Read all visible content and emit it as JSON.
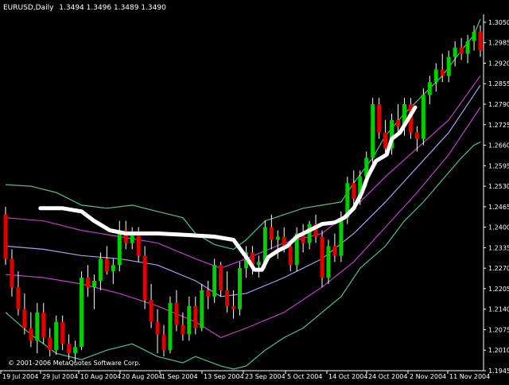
{
  "header": {
    "symbol_period": "EURUSD,Daily",
    "ohlc": "1.3494 1.3496 1.3489 1.3490"
  },
  "copyright": "© 2001-2006 MetaQuotes Software Corp.",
  "colors": {
    "background": "#000000",
    "axis": "#ffffff",
    "bull": "#00d000",
    "bear": "#e00000",
    "wick": "#ffffff",
    "band_outer": "#4fc28a",
    "band_middle": "#c040c8",
    "band_inner": "#b09ce8",
    "overlay": "#ffffff"
  },
  "chart_data": {
    "type": "candlestick",
    "title": "EURUSD,Daily",
    "ylim": [
      1.1945,
      1.3075
    ],
    "y_ticks": [
      "1.3050",
      "1.2985",
      "1.2920",
      "1.2855",
      "1.2790",
      "1.2725",
      "1.2660",
      "1.2595",
      "1.2530",
      "1.2465",
      "1.2400",
      "1.2335",
      "1.2270",
      "1.2205",
      "1.2140",
      "1.2075",
      "1.2010",
      "1.1945"
    ],
    "x_ticks": [
      "19 Jul 2004",
      "29 Jul 2004",
      "10 Aug 2004",
      "20 Aug 2004",
      "1 Sep 2004",
      "13 Sep 2004",
      "23 Sep 2004",
      "5 Oct 2004",
      "14 Oct 2004",
      "24 Oct 2004",
      "2 Nov 2004",
      "11 Nov 2004"
    ],
    "candles": [
      {
        "o": 1.244,
        "h": 1.2465,
        "l": 1.228,
        "c": 1.23
      },
      {
        "o": 1.23,
        "h": 1.233,
        "l": 1.218,
        "c": 1.221
      },
      {
        "o": 1.221,
        "h": 1.226,
        "l": 1.212,
        "c": 1.214
      },
      {
        "o": 1.214,
        "h": 1.219,
        "l": 1.206,
        "c": 1.208
      },
      {
        "o": 1.208,
        "h": 1.213,
        "l": 1.202,
        "c": 1.204
      },
      {
        "o": 1.204,
        "h": 1.216,
        "l": 1.2,
        "c": 1.213
      },
      {
        "o": 1.213,
        "h": 1.216,
        "l": 1.203,
        "c": 1.205
      },
      {
        "o": 1.205,
        "h": 1.208,
        "l": 1.199,
        "c": 1.201
      },
      {
        "o": 1.201,
        "h": 1.212,
        "l": 1.1995,
        "c": 1.21
      },
      {
        "o": 1.21,
        "h": 1.212,
        "l": 1.201,
        "c": 1.203
      },
      {
        "o": 1.203,
        "h": 1.206,
        "l": 1.198,
        "c": 1.2
      },
      {
        "o": 1.2,
        "h": 1.204,
        "l": 1.197,
        "c": 1.202
      },
      {
        "o": 1.202,
        "h": 1.226,
        "l": 1.201,
        "c": 1.224
      },
      {
        "o": 1.224,
        "h": 1.228,
        "l": 1.218,
        "c": 1.221
      },
      {
        "o": 1.221,
        "h": 1.225,
        "l": 1.214,
        "c": 1.223
      },
      {
        "o": 1.223,
        "h": 1.232,
        "l": 1.22,
        "c": 1.23
      },
      {
        "o": 1.23,
        "h": 1.234,
        "l": 1.225,
        "c": 1.226
      },
      {
        "o": 1.226,
        "h": 1.23,
        "l": 1.222,
        "c": 1.228
      },
      {
        "o": 1.228,
        "h": 1.242,
        "l": 1.226,
        "c": 1.239
      },
      {
        "o": 1.239,
        "h": 1.242,
        "l": 1.233,
        "c": 1.235
      },
      {
        "o": 1.235,
        "h": 1.24,
        "l": 1.233,
        "c": 1.238
      },
      {
        "o": 1.238,
        "h": 1.24,
        "l": 1.229,
        "c": 1.231
      },
      {
        "o": 1.231,
        "h": 1.234,
        "l": 1.214,
        "c": 1.217
      },
      {
        "o": 1.217,
        "h": 1.222,
        "l": 1.208,
        "c": 1.21
      },
      {
        "o": 1.21,
        "h": 1.214,
        "l": 1.2,
        "c": 1.206
      },
      {
        "o": 1.206,
        "h": 1.209,
        "l": 1.199,
        "c": 1.201
      },
      {
        "o": 1.201,
        "h": 1.218,
        "l": 1.2,
        "c": 1.216
      },
      {
        "o": 1.216,
        "h": 1.22,
        "l": 1.207,
        "c": 1.209
      },
      {
        "o": 1.209,
        "h": 1.213,
        "l": 1.204,
        "c": 1.206
      },
      {
        "o": 1.206,
        "h": 1.218,
        "l": 1.204,
        "c": 1.215
      },
      {
        "o": 1.215,
        "h": 1.218,
        "l": 1.206,
        "c": 1.208
      },
      {
        "o": 1.208,
        "h": 1.222,
        "l": 1.207,
        "c": 1.22
      },
      {
        "o": 1.22,
        "h": 1.223,
        "l": 1.214,
        "c": 1.218
      },
      {
        "o": 1.218,
        "h": 1.23,
        "l": 1.216,
        "c": 1.228
      },
      {
        "o": 1.228,
        "h": 1.229,
        "l": 1.218,
        "c": 1.22
      },
      {
        "o": 1.22,
        "h": 1.226,
        "l": 1.213,
        "c": 1.215
      },
      {
        "o": 1.215,
        "h": 1.22,
        "l": 1.211,
        "c": 1.214
      },
      {
        "o": 1.214,
        "h": 1.229,
        "l": 1.212,
        "c": 1.227
      },
      {
        "o": 1.227,
        "h": 1.234,
        "l": 1.224,
        "c": 1.232
      },
      {
        "o": 1.232,
        "h": 1.234,
        "l": 1.225,
        "c": 1.228
      },
      {
        "o": 1.228,
        "h": 1.231,
        "l": 1.224,
        "c": 1.229
      },
      {
        "o": 1.229,
        "h": 1.242,
        "l": 1.227,
        "c": 1.24
      },
      {
        "o": 1.24,
        "h": 1.244,
        "l": 1.233,
        "c": 1.236
      },
      {
        "o": 1.236,
        "h": 1.239,
        "l": 1.23,
        "c": 1.237
      },
      {
        "o": 1.237,
        "h": 1.24,
        "l": 1.232,
        "c": 1.234
      },
      {
        "o": 1.234,
        "h": 1.236,
        "l": 1.226,
        "c": 1.228
      },
      {
        "o": 1.228,
        "h": 1.24,
        "l": 1.226,
        "c": 1.238
      },
      {
        "o": 1.238,
        "h": 1.241,
        "l": 1.232,
        "c": 1.235
      },
      {
        "o": 1.235,
        "h": 1.242,
        "l": 1.233,
        "c": 1.241
      },
      {
        "o": 1.241,
        "h": 1.244,
        "l": 1.235,
        "c": 1.237
      },
      {
        "o": 1.237,
        "h": 1.239,
        "l": 1.221,
        "c": 1.224
      },
      {
        "o": 1.224,
        "h": 1.236,
        "l": 1.222,
        "c": 1.234
      },
      {
        "o": 1.234,
        "h": 1.238,
        "l": 1.229,
        "c": 1.231
      },
      {
        "o": 1.231,
        "h": 1.245,
        "l": 1.229,
        "c": 1.243
      },
      {
        "o": 1.243,
        "h": 1.256,
        "l": 1.241,
        "c": 1.254
      },
      {
        "o": 1.254,
        "h": 1.258,
        "l": 1.247,
        "c": 1.249
      },
      {
        "o": 1.249,
        "h": 1.258,
        "l": 1.247,
        "c": 1.256
      },
      {
        "o": 1.256,
        "h": 1.264,
        "l": 1.253,
        "c": 1.262
      },
      {
        "o": 1.262,
        "h": 1.281,
        "l": 1.26,
        "c": 1.279
      },
      {
        "o": 1.279,
        "h": 1.281,
        "l": 1.268,
        "c": 1.27
      },
      {
        "o": 1.27,
        "h": 1.274,
        "l": 1.262,
        "c": 1.265
      },
      {
        "o": 1.265,
        "h": 1.276,
        "l": 1.263,
        "c": 1.274
      },
      {
        "o": 1.274,
        "h": 1.279,
        "l": 1.27,
        "c": 1.272
      },
      {
        "o": 1.272,
        "h": 1.281,
        "l": 1.269,
        "c": 1.279
      },
      {
        "o": 1.279,
        "h": 1.281,
        "l": 1.268,
        "c": 1.27
      },
      {
        "o": 1.27,
        "h": 1.272,
        "l": 1.264,
        "c": 1.268
      },
      {
        "o": 1.268,
        "h": 1.284,
        "l": 1.266,
        "c": 1.282
      },
      {
        "o": 1.282,
        "h": 1.288,
        "l": 1.279,
        "c": 1.286
      },
      {
        "o": 1.286,
        "h": 1.292,
        "l": 1.283,
        "c": 1.29
      },
      {
        "o": 1.29,
        "h": 1.295,
        "l": 1.286,
        "c": 1.288
      },
      {
        "o": 1.288,
        "h": 1.296,
        "l": 1.286,
        "c": 1.294
      },
      {
        "o": 1.294,
        "h": 1.299,
        "l": 1.291,
        "c": 1.297
      },
      {
        "o": 1.297,
        "h": 1.3,
        "l": 1.293,
        "c": 1.295
      },
      {
        "o": 1.295,
        "h": 1.301,
        "l": 1.292,
        "c": 1.299
      },
      {
        "o": 1.299,
        "h": 1.304,
        "l": 1.296,
        "c": 1.302
      },
      {
        "o": 1.302,
        "h": 1.304,
        "l": 1.294,
        "c": 1.296
      }
    ],
    "envelope_lines": [
      {
        "name": "outer-upper",
        "color": "#4fc28a",
        "points": [
          [
            0,
            1.2535
          ],
          [
            4,
            1.253
          ],
          [
            8,
            1.251
          ],
          [
            12,
            1.247
          ],
          [
            16,
            1.246
          ],
          [
            20,
            1.247
          ],
          [
            24,
            1.245
          ],
          [
            28,
            1.243
          ],
          [
            30,
            1.238
          ],
          [
            33,
            1.2345
          ],
          [
            36,
            1.233
          ],
          [
            38,
            1.236
          ],
          [
            41,
            1.242
          ],
          [
            44,
            1.244
          ],
          [
            47,
            1.246
          ],
          [
            50,
            1.247
          ],
          [
            53,
            1.248
          ],
          [
            55,
            1.254
          ],
          [
            58,
            1.262
          ],
          [
            60,
            1.269
          ],
          [
            63,
            1.276
          ],
          [
            66,
            1.282
          ],
          [
            69,
            1.288
          ],
          [
            72,
            1.296
          ],
          [
            74,
            1.301
          ],
          [
            75,
            1.306
          ]
        ]
      },
      {
        "name": "middle-upper",
        "color": "#c040c8",
        "points": [
          [
            0,
            1.243
          ],
          [
            6,
            1.242
          ],
          [
            12,
            1.239
          ],
          [
            18,
            1.237
          ],
          [
            24,
            1.235
          ],
          [
            30,
            1.23
          ],
          [
            34,
            1.227
          ],
          [
            38,
            1.23
          ],
          [
            44,
            1.235
          ],
          [
            50,
            1.238
          ],
          [
            55,
            1.246
          ],
          [
            60,
            1.256
          ],
          [
            65,
            1.265
          ],
          [
            70,
            1.274
          ],
          [
            75,
            1.288
          ]
        ]
      },
      {
        "name": "inner-middle",
        "color": "#b09ce8",
        "points": [
          [
            0,
            1.234
          ],
          [
            6,
            1.233
          ],
          [
            12,
            1.231
          ],
          [
            18,
            1.23
          ],
          [
            24,
            1.228
          ],
          [
            30,
            1.223
          ],
          [
            34,
            1.218
          ],
          [
            38,
            1.219
          ],
          [
            44,
            1.224
          ],
          [
            50,
            1.23
          ],
          [
            55,
            1.238
          ],
          [
            60,
            1.248
          ],
          [
            65,
            1.259
          ],
          [
            70,
            1.27
          ],
          [
            75,
            1.285
          ]
        ]
      },
      {
        "name": "middle-lower",
        "color": "#c040c8",
        "points": [
          [
            0,
            1.225
          ],
          [
            6,
            1.224
          ],
          [
            12,
            1.222
          ],
          [
            18,
            1.219
          ],
          [
            24,
            1.215
          ],
          [
            30,
            1.21
          ],
          [
            34,
            1.205
          ],
          [
            38,
            1.208
          ],
          [
            44,
            1.213
          ],
          [
            50,
            1.221
          ],
          [
            55,
            1.229
          ],
          [
            60,
            1.24
          ],
          [
            65,
            1.251
          ],
          [
            70,
            1.263
          ],
          [
            75,
            1.278
          ]
        ]
      },
      {
        "name": "outer-lower",
        "color": "#4fc28a",
        "points": [
          [
            0,
            1.213
          ],
          [
            4,
            1.206
          ],
          [
            8,
            1.2
          ],
          [
            12,
            1.198
          ],
          [
            16,
            1.201
          ],
          [
            20,
            1.203
          ],
          [
            24,
            1.199
          ],
          [
            28,
            1.197
          ],
          [
            30,
            1.199
          ],
          [
            34,
            1.196
          ],
          [
            36,
            1.195
          ],
          [
            38,
            1.196
          ],
          [
            41,
            1.201
          ],
          [
            44,
            1.205
          ],
          [
            47,
            1.208
          ],
          [
            50,
            1.213
          ],
          [
            53,
            1.218
          ],
          [
            56,
            1.227
          ],
          [
            60,
            1.234
          ],
          [
            63,
            1.242
          ],
          [
            66,
            1.248
          ],
          [
            69,
            1.255
          ],
          [
            72,
            1.262
          ],
          [
            74,
            1.266
          ],
          [
            75,
            1.267
          ]
        ]
      }
    ],
    "overlay_line": {
      "color": "#ffffff",
      "points": [
        [
          5.5,
          1.246
        ],
        [
          9,
          1.246
        ],
        [
          12,
          1.245
        ],
        [
          14,
          1.242
        ],
        [
          16.5,
          1.239
        ],
        [
          19,
          1.238
        ],
        [
          24,
          1.238
        ],
        [
          29,
          1.2375
        ],
        [
          33,
          1.237
        ],
        [
          36,
          1.236
        ],
        [
          38.2,
          1.23
        ],
        [
          39.3,
          1.2265
        ],
        [
          40.5,
          1.2265
        ],
        [
          41.5,
          1.2305
        ],
        [
          43,
          1.2325
        ],
        [
          44.5,
          1.234
        ],
        [
          46,
          1.237
        ],
        [
          48,
          1.239
        ],
        [
          50,
          1.241
        ],
        [
          52,
          1.2415
        ],
        [
          53.5,
          1.243
        ],
        [
          55,
          1.246
        ],
        [
          56.3,
          1.251
        ],
        [
          57.2,
          1.256
        ],
        [
          58.5,
          1.261
        ],
        [
          60.2,
          1.263
        ],
        [
          61,
          1.268
        ],
        [
          62.3,
          1.27
        ],
        [
          63.5,
          1.274
        ],
        [
          64.7,
          1.278
        ]
      ]
    }
  }
}
